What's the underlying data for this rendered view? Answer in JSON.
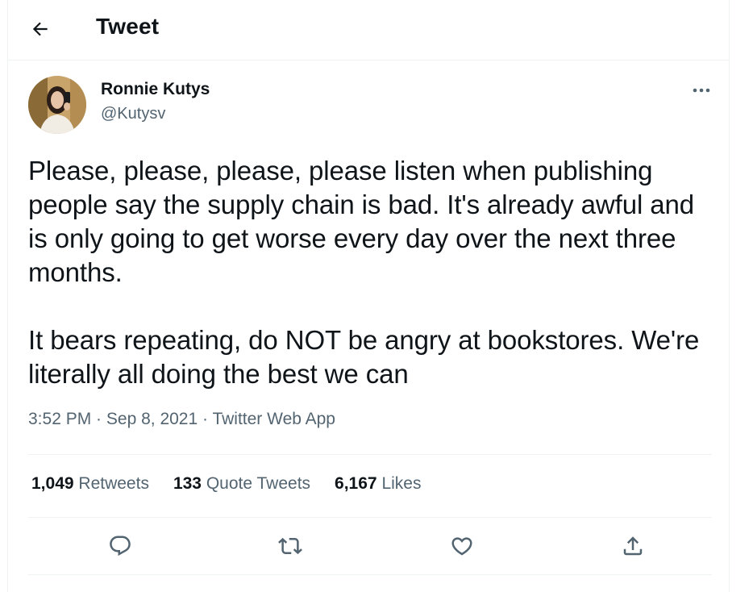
{
  "header": {
    "back_icon": "arrow-left-icon",
    "title": "Tweet"
  },
  "author": {
    "display_name": "Ronnie Kutys",
    "handle": "@Kutysv",
    "avatar_icon": "avatar-photo"
  },
  "tweet": {
    "text": "Please, please, please, please listen when publishing people say the supply chain is bad. It's already awful and is only going to get worse every day over the next three months.\n\nIt bears repeating, do NOT be angry at bookstores. We're literally all doing the best we can",
    "time": "3:52 PM",
    "date": "Sep 8, 2021",
    "source": "Twitter Web App",
    "separator": " · "
  },
  "stats": {
    "retweets_count": "1,049",
    "retweets_label": "Retweets",
    "quotes_count": "133",
    "quotes_label": "Quote Tweets",
    "likes_count": "6,167",
    "likes_label": "Likes"
  },
  "actions": [
    {
      "icon": "reply-icon"
    },
    {
      "icon": "retweet-icon"
    },
    {
      "icon": "like-icon"
    },
    {
      "icon": "share-icon"
    }
  ],
  "colors": {
    "text_primary": "#0f1419",
    "text_secondary": "#536471",
    "divider": "#eff3f4"
  }
}
